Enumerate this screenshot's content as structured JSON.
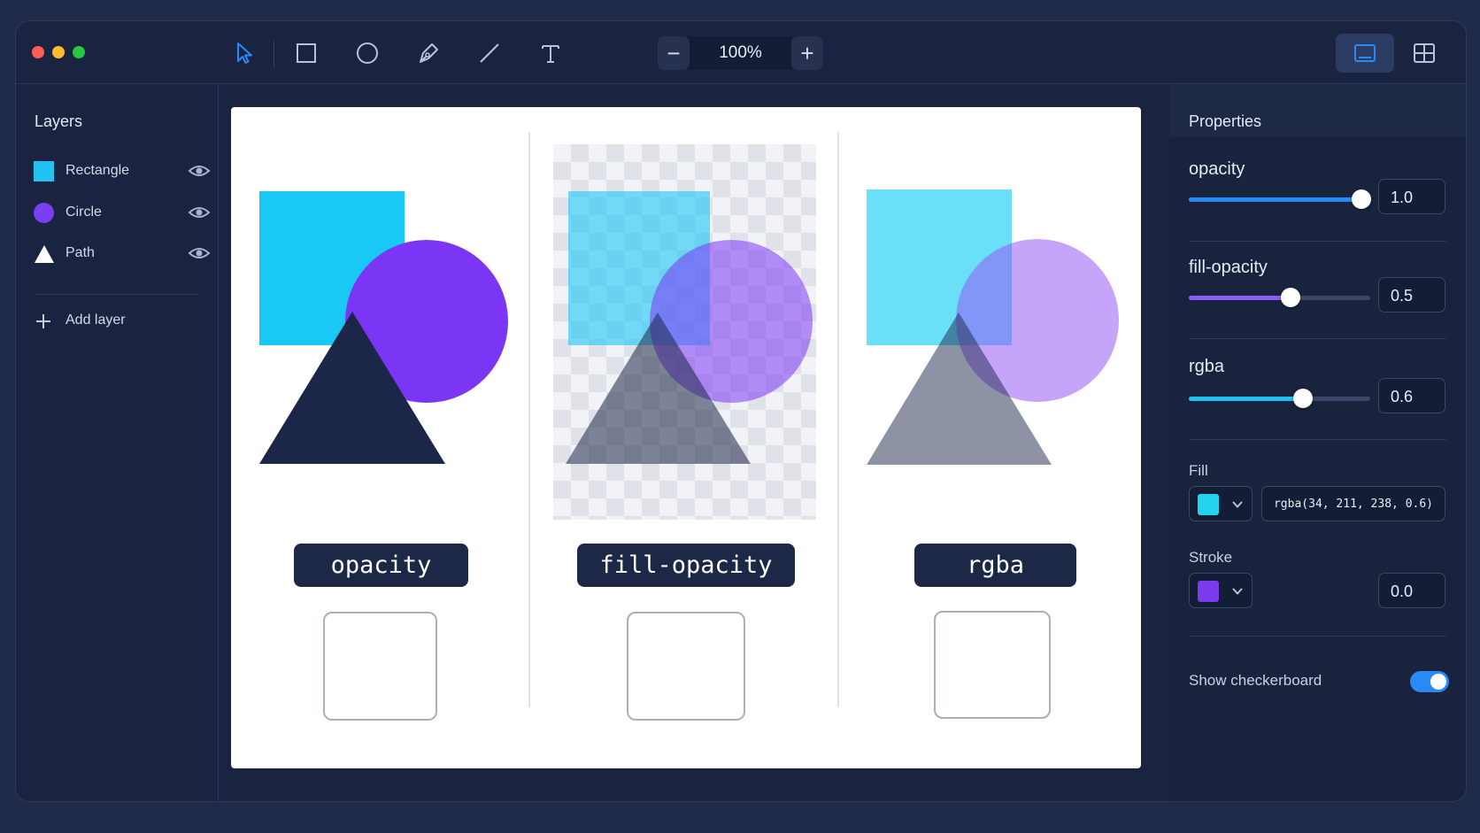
{
  "window": {
    "traffic_colors": [
      "#ff5f57",
      "#febc2e",
      "#28c840"
    ]
  },
  "toolbar": {
    "tools": [
      {
        "name": "select",
        "icon": "cursor-icon",
        "active": true
      },
      {
        "name": "rectangle",
        "icon": "rectangle-icon"
      },
      {
        "name": "ellipse",
        "icon": "ellipse-icon"
      },
      {
        "name": "pen",
        "icon": "pen-icon"
      },
      {
        "name": "line",
        "icon": "line-icon"
      },
      {
        "name": "text",
        "icon": "text-icon"
      }
    ],
    "zoom": {
      "minus": "−",
      "value": "100%",
      "plus": "+"
    },
    "views": [
      {
        "icon": "single-panel-icon",
        "active": true
      },
      {
        "icon": "grid-icon",
        "active": false
      }
    ]
  },
  "layers": {
    "title": "Layers",
    "items": [
      {
        "name": "Rectangle",
        "swatch": "#22c3f2",
        "shape": "square",
        "visible": true
      },
      {
        "name": "Circle",
        "swatch": "#7b3ff2",
        "shape": "circle",
        "visible": true
      },
      {
        "name": "Path",
        "swatch": "#ffffff",
        "shape": "triangle",
        "visible": true
      }
    ],
    "add_label": "Add layer"
  },
  "canvas": {
    "panels": [
      {
        "label": "opacity"
      },
      {
        "label": "fill-opacity"
      },
      {
        "label": "rgba"
      }
    ]
  },
  "properties": {
    "title": "Properties",
    "sliders": [
      {
        "label": "opacity",
        "value": "1.0",
        "fraction": 0.95,
        "color": "#2a8af5"
      },
      {
        "label": "fill-opacity",
        "value": "0.5",
        "fraction": 0.56,
        "color": "#8b5cf6"
      },
      {
        "label": "rgba",
        "value": "0.6",
        "fraction": 0.63,
        "color": "#22c3f2"
      }
    ],
    "fill": {
      "label": "Fill",
      "color": "#22d3ee",
      "value": "rgba(34, 211, 238, 0.6)"
    },
    "stroke": {
      "label": "Stroke",
      "color": "#7c3aed",
      "value": "0.0"
    },
    "checkerboard": {
      "label": "Show checkerboard",
      "on": true
    }
  }
}
